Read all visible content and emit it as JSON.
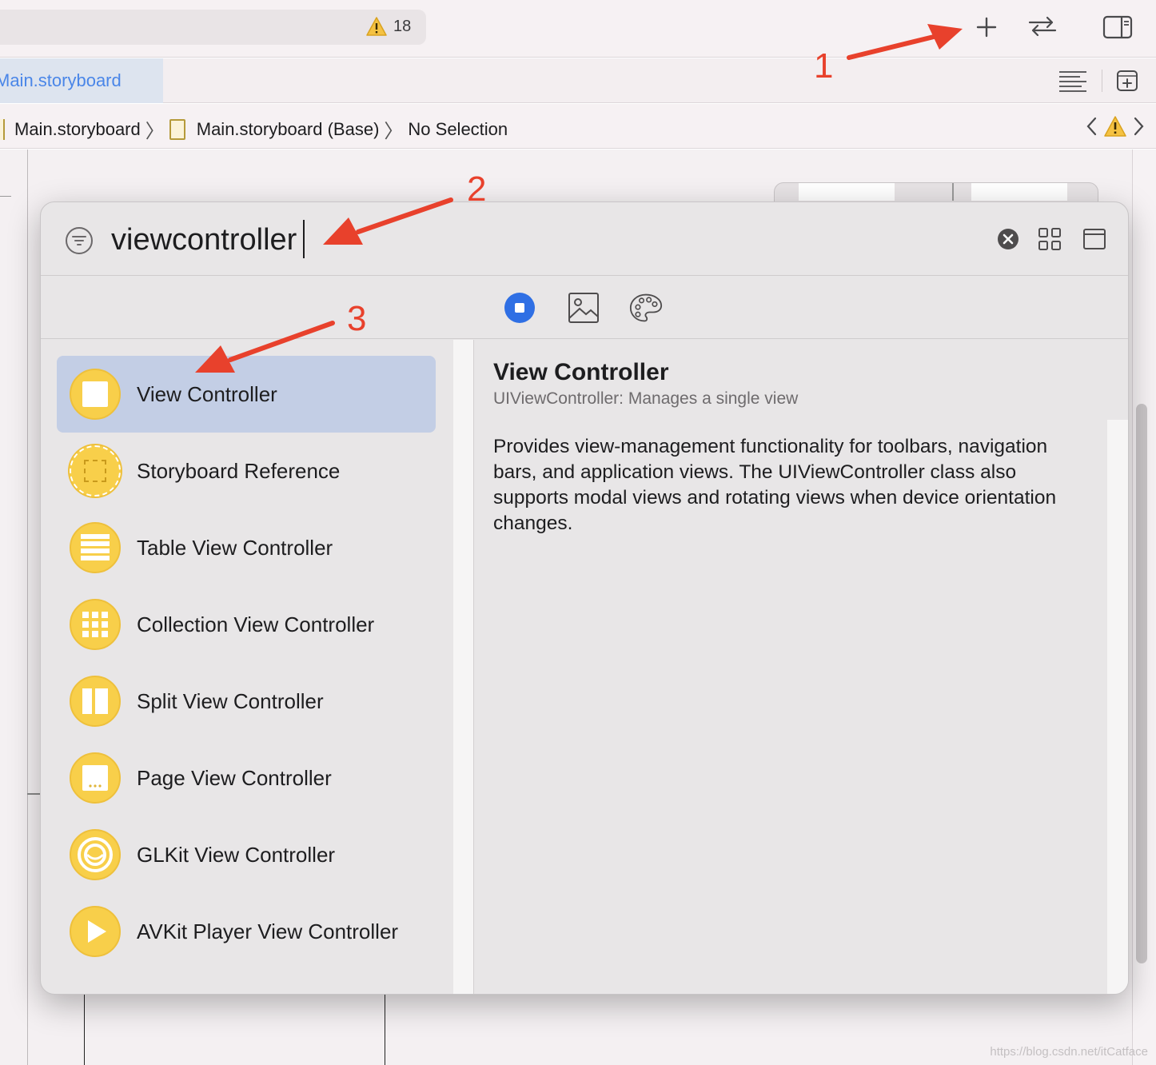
{
  "toolbar": {
    "warning_count": "18",
    "icons": [
      "warning-icon",
      "plus-icon",
      "swap-arrows-icon",
      "inspector-toggle-icon"
    ]
  },
  "tabbar": {
    "active_tab": "Main.storyboard",
    "icons": [
      "text-lines-icon",
      "add-editor-icon"
    ]
  },
  "jumpbar": {
    "crumbs": [
      "Main.storyboard",
      "Main.storyboard (Base)",
      "No Selection"
    ],
    "icons": [
      "chevron-left-icon",
      "warning-icon",
      "chevron-right-icon"
    ]
  },
  "library": {
    "search_value": "viewcontroller",
    "categories": [
      "objects-icon",
      "image-icon",
      "color-palette-icon"
    ],
    "items": [
      {
        "label": "View Controller",
        "icon": "view-controller-icon"
      },
      {
        "label": "Storyboard Reference",
        "icon": "storyboard-reference-icon"
      },
      {
        "label": "Table View Controller",
        "icon": "table-view-controller-icon"
      },
      {
        "label": "Collection View Controller",
        "icon": "collection-view-controller-icon"
      },
      {
        "label": "Split View Controller",
        "icon": "split-view-controller-icon"
      },
      {
        "label": "Page View Controller",
        "icon": "page-view-controller-icon"
      },
      {
        "label": "GLKit View Controller",
        "icon": "glkit-view-controller-icon"
      },
      {
        "label": "AVKit Player View Controller",
        "icon": "avkit-player-icon"
      }
    ],
    "selected_index": 0,
    "detail": {
      "title": "View Controller",
      "subtitle": "UIViewController: Manages a single view",
      "body": "Provides view-management functionality for toolbars, navigation bars, and application views. The UIViewController class also supports modal views and rotating views when device orientation changes."
    }
  },
  "annotations": {
    "step1": "1",
    "step2": "2",
    "step3": "3",
    "color": "#e8412c"
  },
  "watermark": "https://blog.csdn.net/itCatface"
}
